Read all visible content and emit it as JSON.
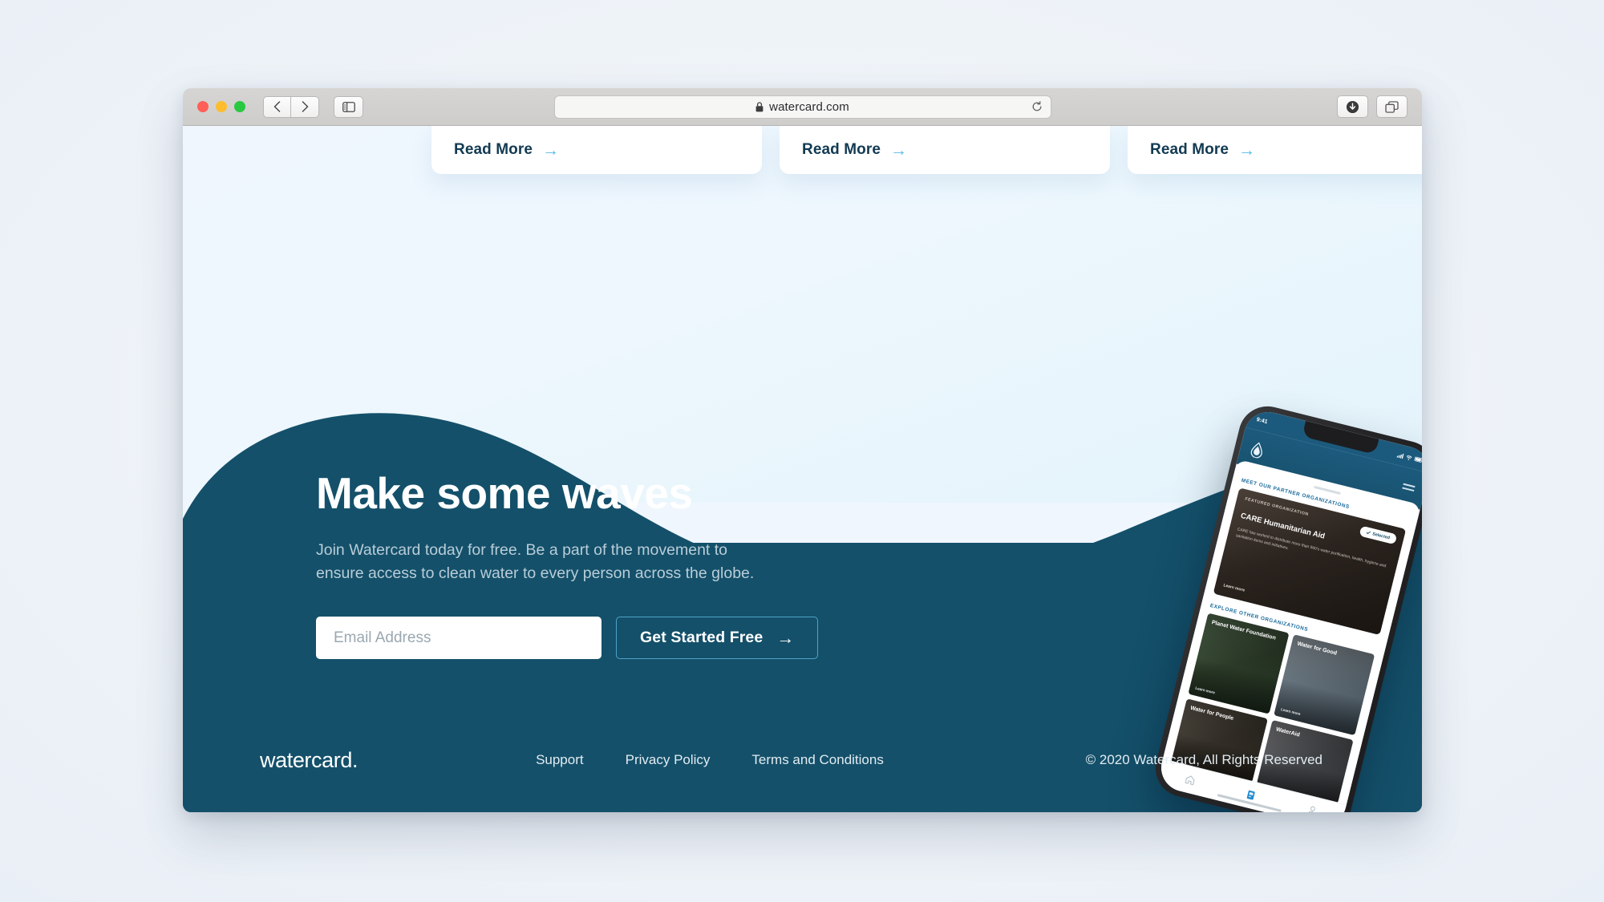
{
  "browser": {
    "url": "watercard.com",
    "lock_icon": "lock-icon",
    "reload_icon": "reload-icon",
    "back_label": "‹",
    "forward_label": "›",
    "sidebar_icon": "sidebar-icon",
    "download_icon": "download-icon",
    "tabs_icon": "tab-overview-icon"
  },
  "cards": [
    {
      "read_more": "Read More",
      "arrow": "→"
    },
    {
      "read_more": "Read More",
      "arrow": "→"
    },
    {
      "read_more": "Read More",
      "arrow": "→"
    }
  ],
  "hero": {
    "heading": "Make some waves",
    "subtitle": "Join Watercard today for free. Be a part of the movement to ensure access to clean water to every person across the globe.",
    "email_placeholder": "Email Address",
    "email_value": "",
    "cta_label": "Get Started Free",
    "cta_arrow": "→"
  },
  "footer": {
    "logo": "watercard.",
    "links": [
      {
        "label": "Support"
      },
      {
        "label": "Privacy Policy"
      },
      {
        "label": "Terms and Conditions"
      }
    ],
    "copyright": "© 2020 Watercard, All Rights Reserved"
  },
  "phone": {
    "status_time": "9:41",
    "app_logo": "water-drop-icon",
    "menu_icon": "hamburger-menu-icon",
    "section_partners": "MEET OUR PARTNER ORGANIZATIONS",
    "featured": {
      "eyebrow": "FEATURED ORGANIZATION",
      "title": "CARE Humanitarian Aid",
      "body": "CARE has worked to distribute more than 960’s water purification, health, hygiene and sanitation items and initiatives.",
      "link": "Learn more",
      "pill": "Selected"
    },
    "section_explore": "EXPLORE OTHER ORGANIZATIONS",
    "orgs": [
      {
        "name": "Planet Water Foundation",
        "link": "Learn more"
      },
      {
        "name": "Water for Good",
        "link": "Learn more"
      },
      {
        "name": "Water for People",
        "link": ""
      },
      {
        "name": "WaterAid",
        "link": ""
      }
    ],
    "tabs": [
      {
        "icon": "home-icon",
        "active": false
      },
      {
        "icon": "card-icon",
        "active": true
      },
      {
        "icon": "profile-icon",
        "active": false
      }
    ]
  },
  "colors": {
    "ocean": "#14506a",
    "sky": "#eff6fe",
    "accent": "#55b9e8",
    "cta_border": "#4ea3c9"
  }
}
